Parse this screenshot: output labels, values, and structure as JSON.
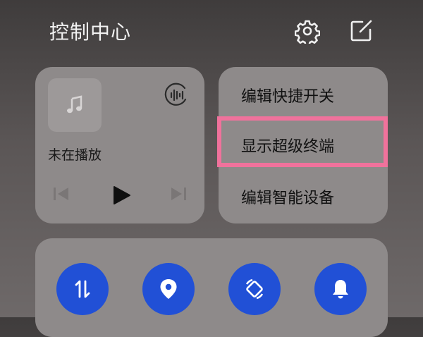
{
  "header": {
    "title": "控制中心",
    "settings_icon": "gear-icon",
    "edit_icon": "edit-square-icon"
  },
  "media": {
    "status": "未在播放",
    "album_icon": "music-note-icon",
    "audio_output_icon": "sound-wave-icon",
    "controls": [
      "previous-icon",
      "play-icon",
      "next-icon"
    ]
  },
  "menu": {
    "items": [
      {
        "label": "编辑快捷开关"
      },
      {
        "label": "显示超级终端",
        "highlighted": true
      },
      {
        "label": "编辑智能设备"
      }
    ]
  },
  "toggles": {
    "items": [
      {
        "icon": "data-transfer-icon"
      },
      {
        "icon": "location-pin-icon"
      },
      {
        "icon": "screen-rotation-icon"
      },
      {
        "icon": "bell-icon"
      }
    ]
  },
  "colors": {
    "toggle_active": "#2150d6",
    "highlight_border": "#f0729c",
    "card_bg": "#8e8a8a"
  }
}
